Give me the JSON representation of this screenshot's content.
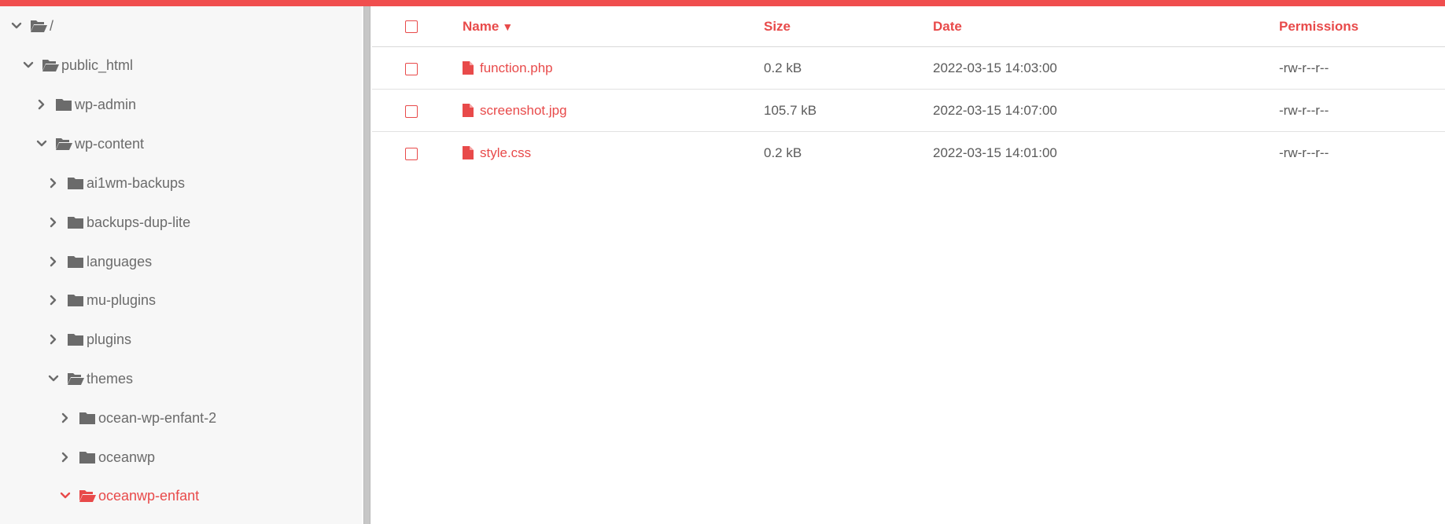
{
  "colors": {
    "accent": "#e84a4a",
    "text": "#5a5a5a",
    "tree_text": "#6b6b6b",
    "sidebar_bg": "#f7f7f7"
  },
  "tree": {
    "items": [
      {
        "label": "/",
        "expanded": true,
        "icon": "folder-open-icon",
        "active": false
      },
      {
        "label": "public_html",
        "expanded": true,
        "icon": "folder-open-icon",
        "active": false
      },
      {
        "label": "wp-admin",
        "expanded": false,
        "icon": "folder-icon",
        "active": false
      },
      {
        "label": "wp-content",
        "expanded": true,
        "icon": "folder-open-icon",
        "active": false
      },
      {
        "label": "ai1wm-backups",
        "expanded": false,
        "icon": "folder-icon",
        "active": false
      },
      {
        "label": "backups-dup-lite",
        "expanded": false,
        "icon": "folder-icon",
        "active": false
      },
      {
        "label": "languages",
        "expanded": false,
        "icon": "folder-icon",
        "active": false
      },
      {
        "label": "mu-plugins",
        "expanded": false,
        "icon": "folder-icon",
        "active": false
      },
      {
        "label": "plugins",
        "expanded": false,
        "icon": "folder-icon",
        "active": false
      },
      {
        "label": "themes",
        "expanded": true,
        "icon": "folder-open-icon",
        "active": false
      },
      {
        "label": "ocean-wp-enfant-2",
        "expanded": false,
        "icon": "folder-icon",
        "active": false
      },
      {
        "label": "oceanwp",
        "expanded": false,
        "icon": "folder-icon",
        "active": false
      },
      {
        "label": "oceanwp-enfant",
        "expanded": true,
        "icon": "folder-open-icon",
        "active": true
      }
    ]
  },
  "table": {
    "headers": {
      "name": "Name",
      "sort_indicator": "▼",
      "size": "Size",
      "date": "Date",
      "permissions": "Permissions"
    },
    "rows": [
      {
        "name": "function.php",
        "size": "0.2 kB",
        "date": "2022-03-15 14:03:00",
        "permissions": "-rw-r--r--",
        "icon": "file-icon"
      },
      {
        "name": "screenshot.jpg",
        "size": "105.7 kB",
        "date": "2022-03-15 14:07:00",
        "permissions": "-rw-r--r--",
        "icon": "file-icon"
      },
      {
        "name": "style.css",
        "size": "0.2 kB",
        "date": "2022-03-15 14:01:00",
        "permissions": "-rw-r--r--",
        "icon": "file-icon"
      }
    ]
  }
}
